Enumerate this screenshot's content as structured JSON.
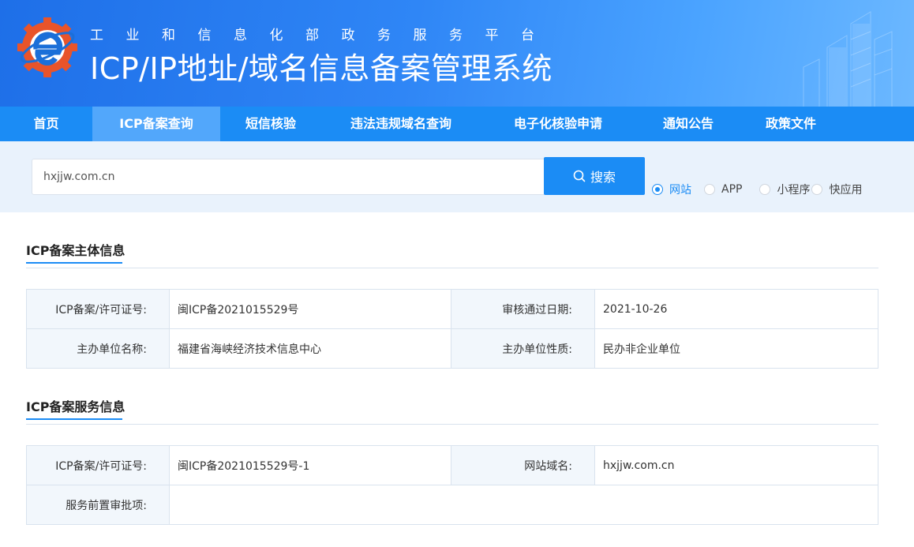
{
  "header": {
    "subtitle": "工业和信息化部政务服务平台",
    "title": "ICP/IP地址/域名信息备案管理系统"
  },
  "nav": {
    "items": [
      {
        "label": "首页"
      },
      {
        "label": "ICP备案查询"
      },
      {
        "label": "短信核验"
      },
      {
        "label": "违法违规域名查询"
      },
      {
        "label": "电子化核验申请"
      },
      {
        "label": "通知公告"
      },
      {
        "label": "政策文件"
      }
    ],
    "active": "ICP备案查询"
  },
  "search": {
    "value": "hxjjw.com.cn",
    "button_label": "搜索",
    "types": [
      {
        "label": "网站",
        "checked": true
      },
      {
        "label": "APP",
        "checked": false
      },
      {
        "label": "小程序",
        "checked": false
      },
      {
        "label": "快应用",
        "checked": false
      }
    ]
  },
  "subject_info": {
    "title": "ICP备案主体信息",
    "license_label": "ICP备案/许可证号:",
    "license_value": "闽ICP备2021015529号",
    "date_label": "审核通过日期:",
    "date_value": "2021-10-26",
    "org_label": "主办单位名称:",
    "org_value": "福建省海峡经济技术信息中心",
    "nature_label": "主办单位性质:",
    "nature_value": "民办非企业单位"
  },
  "service_info": {
    "title": "ICP备案服务信息",
    "license_label": "ICP备案/许可证号:",
    "license_value": "闽ICP备2021015529号-1",
    "domain_label": "网站域名:",
    "domain_value": "hxjjw.com.cn",
    "approval_label": "服务前置审批项:",
    "approval_value": ""
  },
  "colors": {
    "primary": "#1b8cf5",
    "nav_active": "#52a7fb",
    "search_bg": "#e9f2fc",
    "table_key_bg": "#f2f7fc"
  }
}
